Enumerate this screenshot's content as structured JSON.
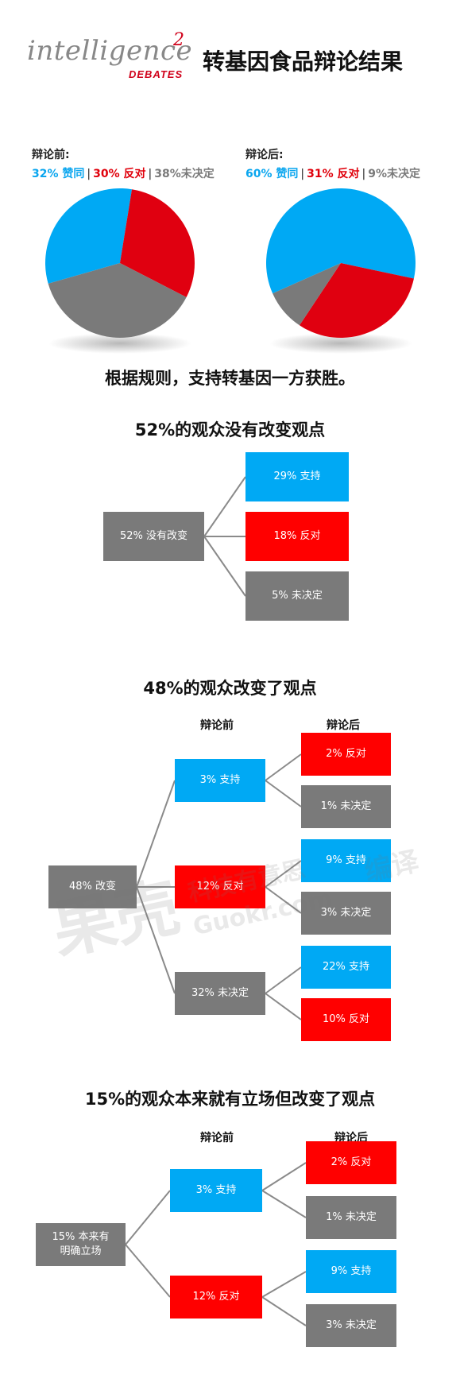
{
  "header": {
    "logo_word": "intelligence",
    "logo_sup": "2",
    "logo_sub": "DEBATES",
    "title": "转基因食品辩论结果"
  },
  "colors": {
    "support": "#00a9f4",
    "oppose": "#e00010",
    "undecided": "#7a7a7a"
  },
  "pies": {
    "before": {
      "heading": "辩论前:",
      "legend": {
        "support": "32% 赞同",
        "oppose": "30% 反对",
        "undecided": "38%未决定"
      }
    },
    "after": {
      "heading": "辩论后:",
      "legend": {
        "support": "60% 赞同",
        "oppose": "31% 反对",
        "undecided": "9%未决定"
      }
    }
  },
  "chart_data": [
    {
      "type": "pie",
      "title": "辩论前:",
      "categories": [
        "赞同",
        "反对",
        "未决定"
      ],
      "values": [
        32,
        30,
        38
      ]
    },
    {
      "type": "pie",
      "title": "辩论后:",
      "categories": [
        "赞同",
        "反对",
        "未决定"
      ],
      "values": [
        60,
        31,
        9
      ]
    }
  ],
  "statement": "根据规则，支持转基因一方获胜。",
  "section1": {
    "title": "52%的观众没有改变观点",
    "root": "52% 没有改变",
    "leaves": [
      "29% 支持",
      "18% 反对",
      "5% 未决定"
    ]
  },
  "section2": {
    "title": "48%的观众改变了观点",
    "col_before": "辩论前",
    "col_after": "辩论后",
    "root": "48% 改变",
    "mid": [
      "3% 支持",
      "12% 反对",
      "32% 未决定"
    ],
    "leaves": [
      "2% 反对",
      "1% 未决定",
      "9% 支持",
      "3% 未决定",
      "22% 支持",
      "10% 反对"
    ]
  },
  "section3": {
    "title": "15%的观众本来就有立场但改变了观点",
    "col_before": "辩论前",
    "col_after": "辩论后",
    "root_line1": "15% 本来有",
    "root_line2": "明确立场",
    "mid": [
      "3% 支持",
      "12% 反对"
    ],
    "leaves": [
      "2% 反对",
      "1% 未决定",
      "9% 支持",
      "3% 未决定"
    ]
  },
  "watermark": {
    "big": "果壳",
    "small": "科技有意思",
    "url": "Guokr.com",
    "edit": "编译"
  }
}
